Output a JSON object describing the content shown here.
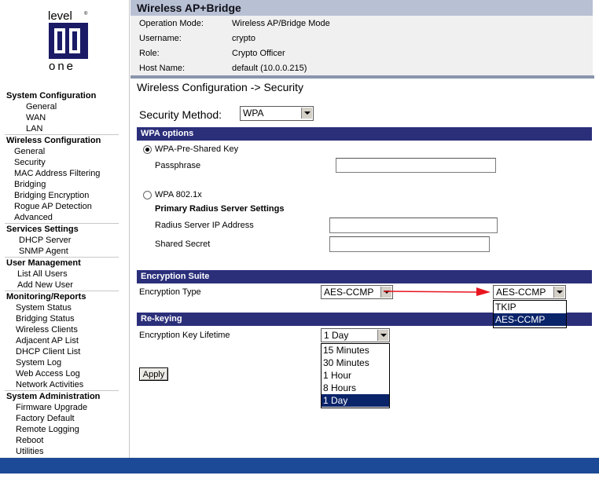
{
  "logo": {
    "line1": "level",
    "line2": "one",
    "mark": "®"
  },
  "nav": {
    "system_configuration": {
      "label": "System Configuration",
      "items": [
        "General",
        "WAN",
        "LAN"
      ]
    },
    "wireless_configuration": {
      "label": "Wireless Configuration",
      "items": [
        "General",
        "Security",
        "MAC Address Filtering",
        "Bridging",
        "Bridging Encryption",
        "Rogue AP Detection",
        "Advanced"
      ]
    },
    "services_settings": {
      "label": "Services Settings",
      "items": [
        "DHCP Server",
        "SNMP Agent"
      ]
    },
    "user_management": {
      "label": "User Management",
      "items": [
        "List All Users",
        "Add New User"
      ]
    },
    "monitoring_reports": {
      "label": "Monitoring/Reports",
      "items": [
        "System Status",
        "Bridging Status",
        "Wireless Clients",
        "Adjacent AP List",
        "DHCP Client List",
        "System Log",
        "Web Access Log",
        "Network Activities"
      ]
    },
    "system_administration": {
      "label": "System Administration",
      "items": [
        "Firmware Upgrade",
        "Factory Default",
        "Remote Logging",
        "Reboot",
        "Utilities"
      ]
    }
  },
  "header": {
    "title": "Wireless AP+Bridge",
    "info": [
      {
        "label": "Operation Mode:",
        "value": "Wireless AP/Bridge Mode"
      },
      {
        "label": "Username:",
        "value": "crypto"
      },
      {
        "label": "Role:",
        "value": "Crypto Officer"
      },
      {
        "label": "Host Name:",
        "value": "default (10.0.0.215)"
      }
    ]
  },
  "page_title": "Wireless Configuration -> Security",
  "security_method": {
    "label": "Security Method:",
    "value": "WPA"
  },
  "wpa_options": {
    "section": "WPA options",
    "psk_label": "WPA-Pre-Shared Key",
    "passphrase_label": "Passphrase",
    "passphrase_value": "",
    "dot1x_label": "WPA 802.1x",
    "radius_heading": "Primary Radius Server Settings",
    "radius_ip_label": "Radius Server IP Address",
    "radius_ip_value": "",
    "shared_secret_label": "Shared Secret",
    "shared_secret_value": ""
  },
  "encryption_suite": {
    "section": "Encryption Suite",
    "type_label": "Encryption Type",
    "value": "AES-CCMP",
    "dropdown_value": "AES-CCMP",
    "options": [
      "TKIP",
      "AES-CCMP"
    ],
    "selected_option": "AES-CCMP"
  },
  "rekeying": {
    "section": "Re-keying",
    "lifetime_label": "Encryption Key Lifetime",
    "value": "1 Day",
    "options": [
      "15 Minutes",
      "30 Minutes",
      "1 Hour",
      "8 Hours",
      "1 Day"
    ],
    "selected_option": "1 Day"
  },
  "apply_label": "Apply",
  "colors": {
    "section_bar": "#2b2f7a",
    "title_bar": "#b8c0d4",
    "footer": "#1c4a96",
    "selection": "#0a246a",
    "annotation_arrow": "#e8141e"
  }
}
